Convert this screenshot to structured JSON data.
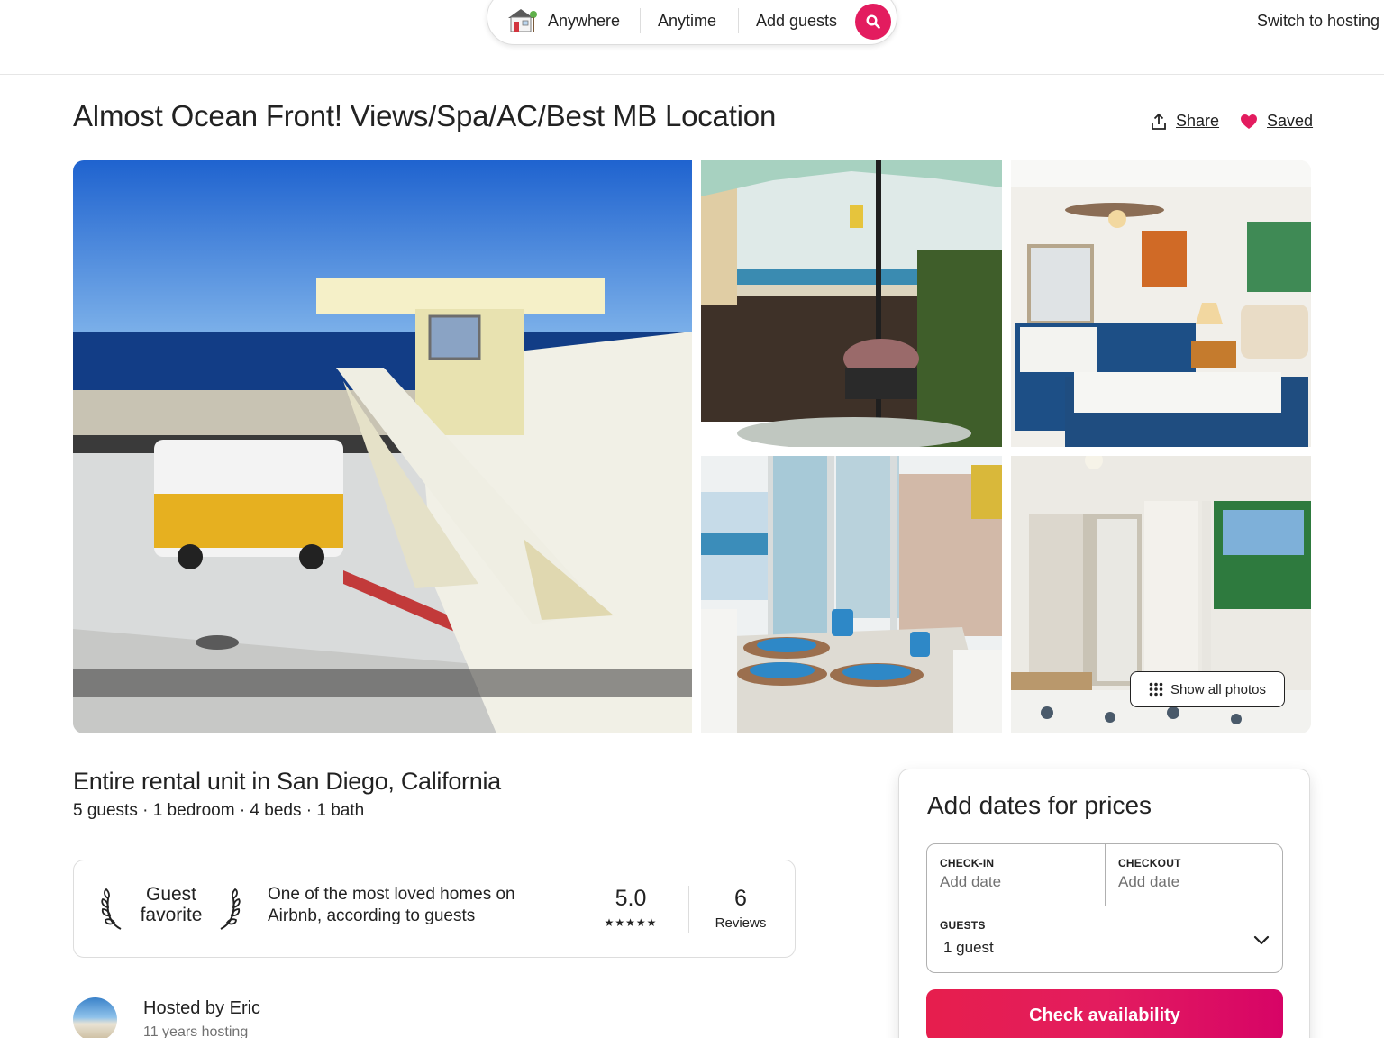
{
  "header": {
    "search": {
      "anywhere_label": "Anywhere",
      "anytime_label": "Anytime",
      "guests_label": "Add guests"
    },
    "switch_hosting_label": "Switch to hosting"
  },
  "listing": {
    "title": "Almost Ocean Front! Views/Spa/AC/Best MB Location",
    "share_label": "Share",
    "saved_label": "Saved",
    "show_all_photos_label": "Show all photos",
    "type_heading": "Entire rental unit in San Diego, California",
    "details": "5 guests · 1 bedroom · 4 beds · 1 bath",
    "guest_favorite": {
      "badge_line1": "Guest",
      "badge_line2": "favorite",
      "description": "One of the most loved homes on Airbnb, according to guests",
      "rating": "5.0",
      "stars": "★★★★★",
      "star_count": 5,
      "reviews_count": "6",
      "reviews_label": "Reviews"
    },
    "host": {
      "name": "Hosted by Eric",
      "years": "11 years hosting"
    }
  },
  "booking": {
    "title": "Add dates for prices",
    "checkin_label": "CHECK-IN",
    "checkin_value": "Add date",
    "checkout_label": "CHECKOUT",
    "checkout_value": "Add date",
    "guests_label": "GUESTS",
    "guests_value": "1 guest",
    "check_button_label": "Check availability"
  },
  "colors": {
    "brand": "#e31c5f",
    "saved_heart": "#e31c5f",
    "text": "#222222",
    "muted": "#717171",
    "border": "#dddddd"
  },
  "icons": {
    "search_bar_logo": "house-icon",
    "search": "search-icon",
    "share": "share-icon",
    "saved": "heart-icon",
    "show_all": "grid-dots-icon",
    "laurel": "laurel-icon",
    "guests_dropdown": "chevron-down-icon"
  }
}
